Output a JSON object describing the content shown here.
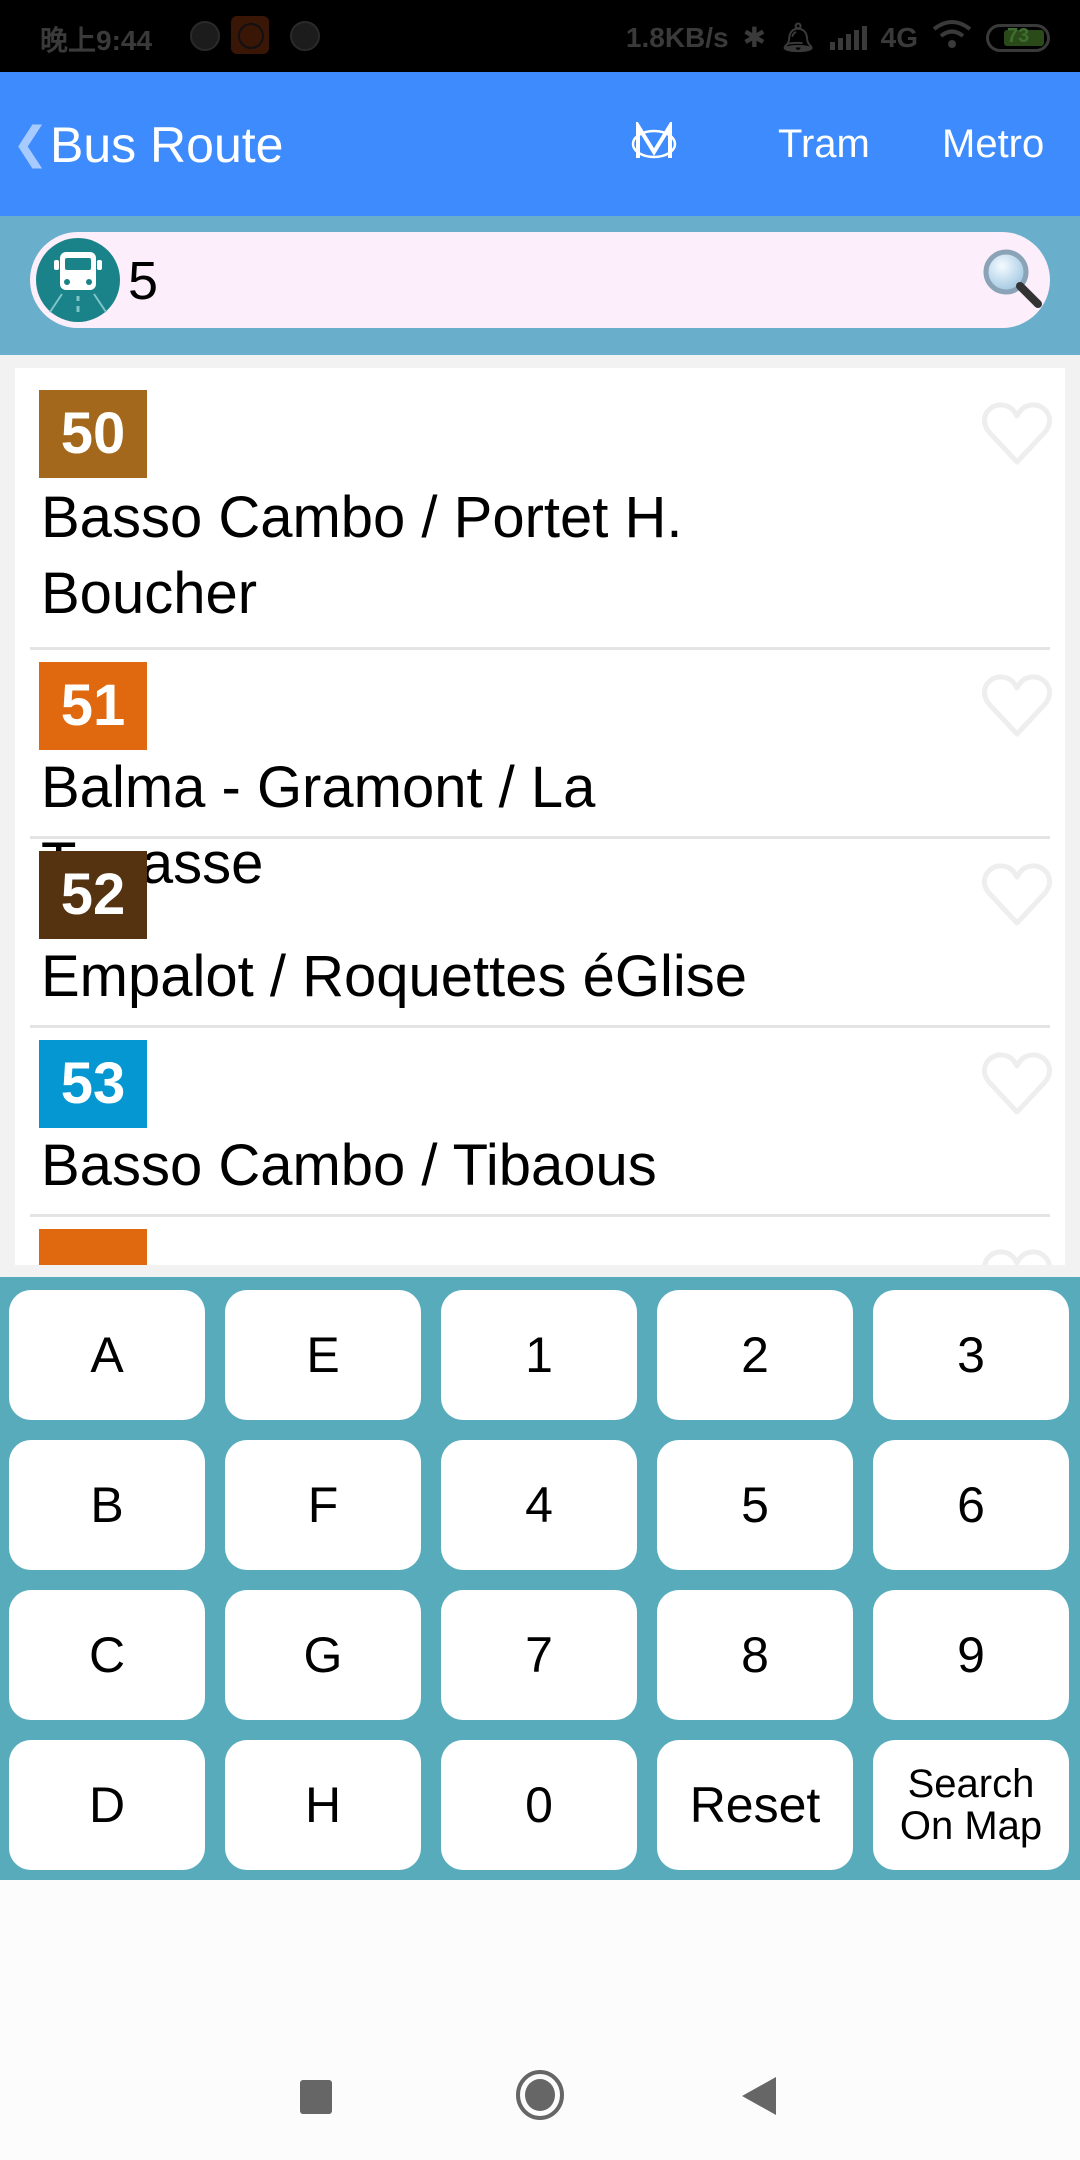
{
  "status_bar": {
    "time": "晚上9:44",
    "network_speed": "1.8KB/s",
    "network_type": "4G",
    "battery": "73"
  },
  "header": {
    "back_icon": "chevron-left-icon",
    "title": "Bus Route",
    "metro_logo_icon": "metro-logo-icon",
    "tabs": [
      {
        "label": "Tram"
      },
      {
        "label": "Metro"
      }
    ]
  },
  "search": {
    "value": "5",
    "leading_icon": "bus-icon",
    "button_icon": "magnifier-icon"
  },
  "routes": [
    {
      "number": "50",
      "color": "#a3681b",
      "name": "Basso Cambo / Portet H. Boucher",
      "favorite": false
    },
    {
      "number": "51",
      "color": "#e0690f",
      "name": "Balma - Gramont / La Terrasse",
      "favorite": false
    },
    {
      "number": "52",
      "color": "#553210",
      "name": "Empalot / Roquettes éGlise",
      "favorite": false
    },
    {
      "number": "53",
      "color": "#0597d2",
      "name": "Basso Cambo / Tibaous",
      "favorite": false
    },
    {
      "number": "",
      "color": "#e0690f",
      "name": "",
      "favorite": false
    }
  ],
  "keypad": {
    "keys": [
      [
        "A",
        "E",
        "1",
        "2",
        "3"
      ],
      [
        "B",
        "F",
        "4",
        "5",
        "6"
      ],
      [
        "C",
        "G",
        "7",
        "8",
        "9"
      ],
      [
        "D",
        "H",
        "0",
        "Reset",
        "Search On Map"
      ]
    ]
  },
  "nav_bar": {
    "recents_icon": "square-icon",
    "home_icon": "circle-icon",
    "back_icon": "triangle-back-icon"
  }
}
